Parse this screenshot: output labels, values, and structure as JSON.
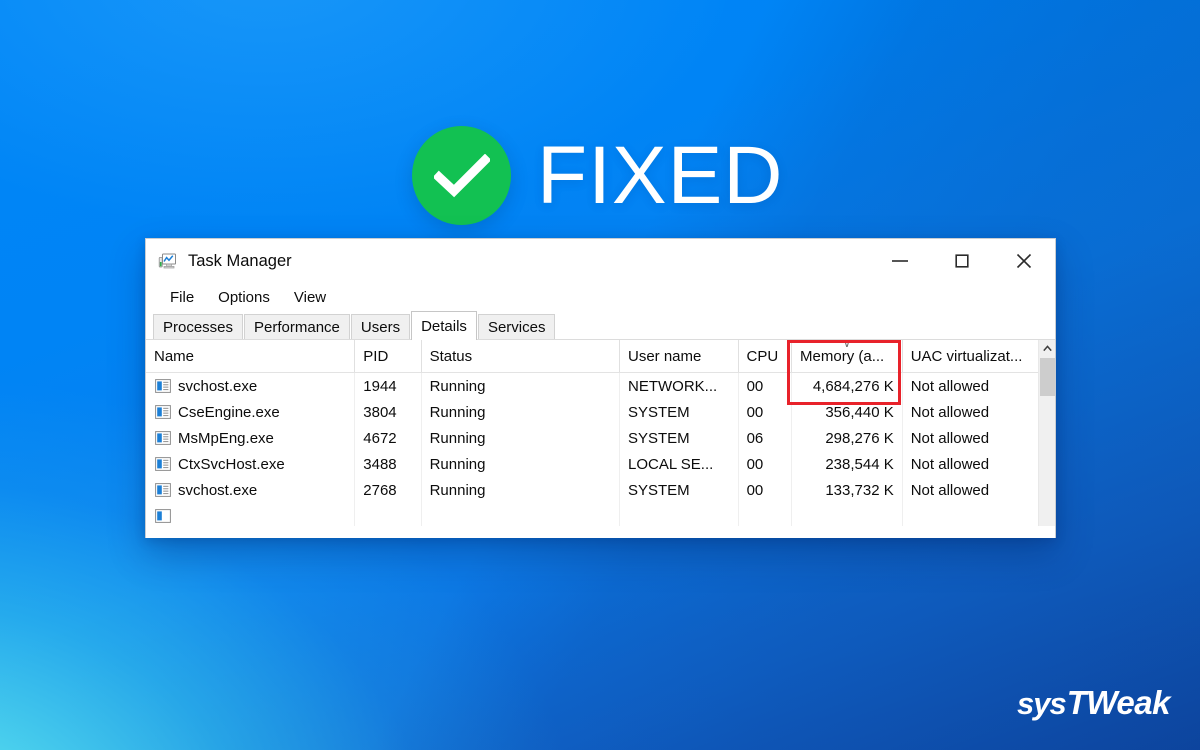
{
  "background": {
    "top_color": "#0084F5",
    "bottom_left_color": "#4FD8EE",
    "bottom_right_color": "#0F4EAE"
  },
  "banner": {
    "label": "FIXED",
    "badge_icon": "check-circle-icon",
    "badge_color": "#12C152",
    "text_color": "#FFFFFF"
  },
  "window": {
    "icon": "task-manager-icon",
    "title": "Task Manager",
    "controls": [
      {
        "name": "minimize",
        "icon": "minimize-icon"
      },
      {
        "name": "maximize",
        "icon": "maximize-icon"
      },
      {
        "name": "close",
        "icon": "close-icon"
      }
    ],
    "menu": [
      {
        "label": "File"
      },
      {
        "label": "Options"
      },
      {
        "label": "View"
      }
    ],
    "tabs": [
      {
        "label": "Processes",
        "active": false
      },
      {
        "label": "Performance",
        "active": false
      },
      {
        "label": "Users",
        "active": false
      },
      {
        "label": "Details",
        "active": true
      },
      {
        "label": "Services",
        "active": false
      }
    ]
  },
  "table": {
    "columns": [
      {
        "key": "name",
        "label": "Name",
        "align": "left"
      },
      {
        "key": "pid",
        "label": "PID",
        "align": "left"
      },
      {
        "key": "status",
        "label": "Status",
        "align": "left"
      },
      {
        "key": "user",
        "label": "User name",
        "align": "left"
      },
      {
        "key": "cpu",
        "label": "CPU",
        "align": "left"
      },
      {
        "key": "memory",
        "label": "Memory (a...",
        "align": "right",
        "sorted": true,
        "sort_direction": "descending",
        "sort_icon": "chevron-down-icon"
      },
      {
        "key": "uac",
        "label": "UAC virtualizat...",
        "align": "left"
      }
    ],
    "rows": [
      {
        "name": "svchost.exe",
        "pid": "1944",
        "status": "Running",
        "user": "NETWORK...",
        "cpu": "00",
        "memory": "4,684,276 K",
        "uac": "Not allowed"
      },
      {
        "name": "CseEngine.exe",
        "pid": "3804",
        "status": "Running",
        "user": "SYSTEM",
        "cpu": "00",
        "memory": "356,440 K",
        "uac": "Not allowed"
      },
      {
        "name": "MsMpEng.exe",
        "pid": "4672",
        "status": "Running",
        "user": "SYSTEM",
        "cpu": "06",
        "memory": "298,276 K",
        "uac": "Not allowed"
      },
      {
        "name": "CtxSvcHost.exe",
        "pid": "3488",
        "status": "Running",
        "user": "LOCAL SE...",
        "cpu": "00",
        "memory": "238,544 K",
        "uac": "Not allowed"
      },
      {
        "name": "svchost.exe",
        "pid": "2768",
        "status": "Running",
        "user": "SYSTEM",
        "cpu": "00",
        "memory": "133,732 K",
        "uac": "Not allowed"
      }
    ],
    "highlight": {
      "column": "memory",
      "color": "#E8222A",
      "highlighted_value": "4,684,276 K"
    },
    "scrollbar": {
      "up_arrow_icon": "chevron-up-icon"
    }
  },
  "logo": {
    "part_one": "sys",
    "part_two": "TWeak"
  }
}
